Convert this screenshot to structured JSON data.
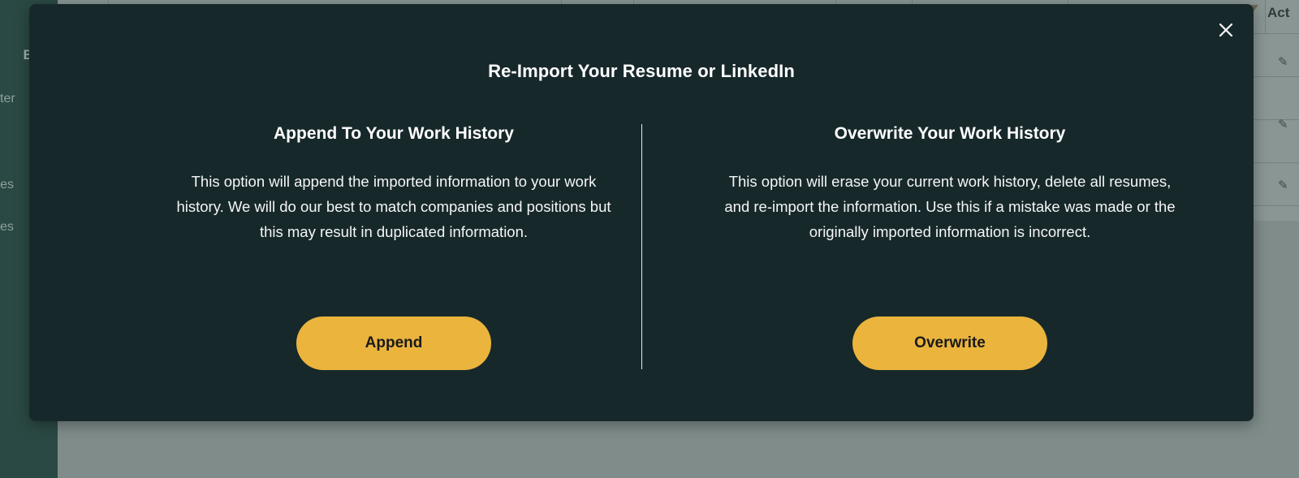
{
  "background": {
    "sidebar": {
      "items": [
        {
          "label": "Build",
          "style": "bold"
        },
        {
          "label": "ter",
          "style": "normal"
        },
        {
          "label": "es",
          "style": "normal"
        },
        {
          "label": "es",
          "style": "normal"
        }
      ]
    },
    "table": {
      "actions_header": "Act",
      "edit_icon": "pencil-icon"
    }
  },
  "modal": {
    "title": "Re-Import Your Resume or LinkedIn",
    "close_icon": "close-icon",
    "append": {
      "heading": "Append To Your Work History",
      "description": "This option will append the imported information to your work history. We will do our best to match companies and positions but this may result in duplicated information.",
      "button_label": "Append"
    },
    "overwrite": {
      "heading": "Overwrite Your Work History",
      "description": "This option will erase your current work history, delete all resumes, and re-import the information. Use this if a mistake was made or the originally imported information is incorrect.",
      "button_label": "Overwrite"
    }
  },
  "colors": {
    "modal_background": "#17282b",
    "button_accent": "#ebb43d",
    "overlay": "#7f8c8a",
    "sidebar": "#2b4944"
  }
}
